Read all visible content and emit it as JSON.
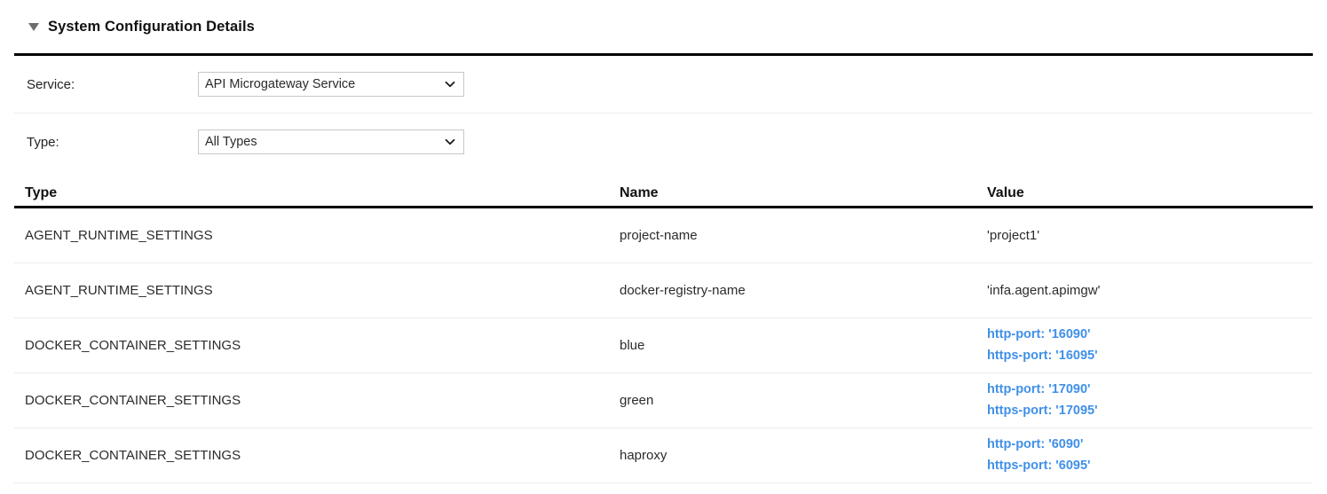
{
  "section": {
    "title": "System Configuration Details",
    "collapse_icon": "triangle-down-icon"
  },
  "filters": {
    "service": {
      "label": "Service:",
      "value": "API Microgateway Service",
      "icon": "chevron-down-icon"
    },
    "type": {
      "label": "Type:",
      "value": "All Types",
      "icon": "chevron-down-icon"
    }
  },
  "table": {
    "columns": [
      "Type",
      "Name",
      "Value"
    ],
    "rows": [
      {
        "type": "AGENT_RUNTIME_SETTINGS",
        "name": "project-name",
        "value": "'project1'",
        "highlight": false
      },
      {
        "type": "AGENT_RUNTIME_SETTINGS",
        "name": "docker-registry-name",
        "value": "'infa.agent.apimgw'",
        "highlight": false
      },
      {
        "type": "DOCKER_CONTAINER_SETTINGS",
        "name": "blue",
        "value": "http-port: '16090'\nhttps-port: '16095'",
        "highlight": true
      },
      {
        "type": "DOCKER_CONTAINER_SETTINGS",
        "name": "green",
        "value": "http-port: '17090'\nhttps-port: '17095'",
        "highlight": true
      },
      {
        "type": "DOCKER_CONTAINER_SETTINGS",
        "name": "haproxy",
        "value": "http-port: '6090'\nhttps-port: '6095'",
        "highlight": true
      }
    ]
  },
  "colors": {
    "value_highlight": "#4090e8",
    "rule": "#000000",
    "separator": "#ececec"
  }
}
